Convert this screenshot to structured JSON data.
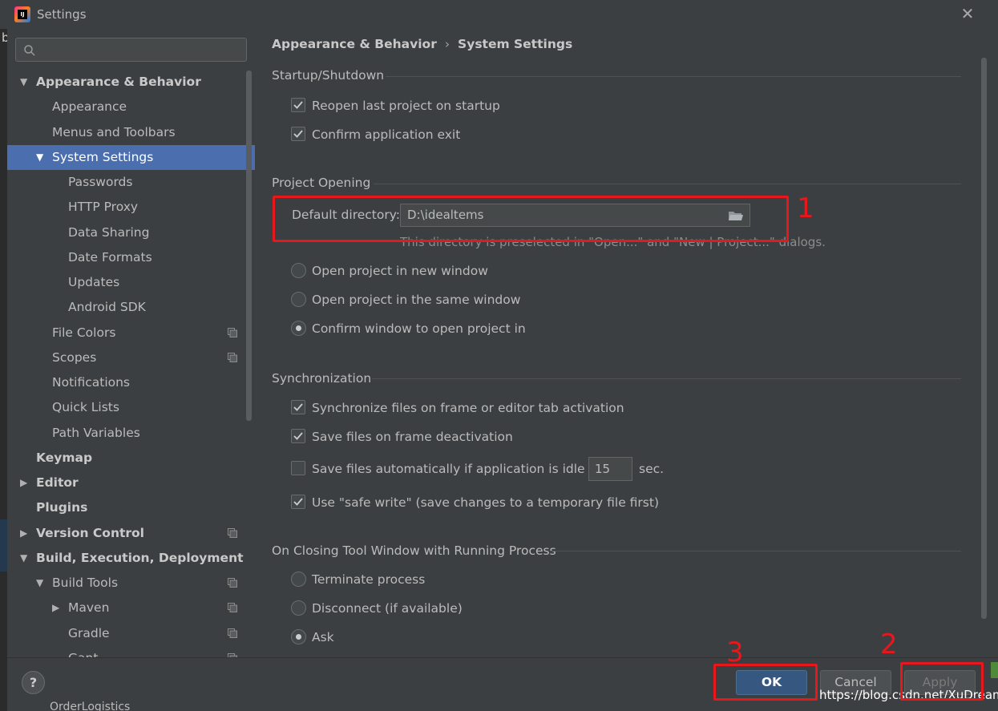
{
  "window": {
    "title": "Settings",
    "app_icon": "intellij-idea-icon"
  },
  "search": {
    "placeholder": ""
  },
  "sidebar": {
    "items": [
      {
        "label": "Appearance & Behavior",
        "level": 0,
        "expanded": true,
        "bold": true
      },
      {
        "label": "Appearance",
        "level": 1
      },
      {
        "label": "Menus and Toolbars",
        "level": 1
      },
      {
        "label": "System Settings",
        "level": 1,
        "expanded": true,
        "selected": true
      },
      {
        "label": "Passwords",
        "level": 2
      },
      {
        "label": "HTTP Proxy",
        "level": 2
      },
      {
        "label": "Data Sharing",
        "level": 2
      },
      {
        "label": "Date Formats",
        "level": 2
      },
      {
        "label": "Updates",
        "level": 2
      },
      {
        "label": "Android SDK",
        "level": 2
      },
      {
        "label": "File Colors",
        "level": 1,
        "project": true
      },
      {
        "label": "Scopes",
        "level": 1,
        "project": true
      },
      {
        "label": "Notifications",
        "level": 1
      },
      {
        "label": "Quick Lists",
        "level": 1
      },
      {
        "label": "Path Variables",
        "level": 1
      },
      {
        "label": "Keymap",
        "level": 0,
        "bold": true
      },
      {
        "label": "Editor",
        "level": 0,
        "collapsed": true,
        "bold": true
      },
      {
        "label": "Plugins",
        "level": 0,
        "bold": true
      },
      {
        "label": "Version Control",
        "level": 0,
        "collapsed": true,
        "bold": true,
        "project": true
      },
      {
        "label": "Build, Execution, Deployment",
        "level": 0,
        "expanded": true,
        "bold": true
      },
      {
        "label": "Build Tools",
        "level": 1,
        "expanded": true,
        "project": true
      },
      {
        "label": "Maven",
        "level": 2,
        "collapsed": true,
        "project": true
      },
      {
        "label": "Gradle",
        "level": 2,
        "project": true
      },
      {
        "label": "Gant",
        "level": 2,
        "project": true
      }
    ]
  },
  "breadcrumb": {
    "parent": "Appearance & Behavior",
    "separator": "›",
    "current": "System Settings"
  },
  "sections": {
    "startup": {
      "title": "Startup/Shutdown",
      "reopen_label": "Reopen last project on startup",
      "confirm_exit_label": "Confirm application exit"
    },
    "project_opening": {
      "title": "Project Opening",
      "default_dir_label": "Default directory:",
      "default_dir_value": "D:\\idealtems",
      "hint": "This directory is preselected in \"Open...\" and \"New | Project...\" dialogs.",
      "radio_new_window": "Open project in new window",
      "radio_same_window": "Open project in the same window",
      "radio_confirm": "Confirm window to open project in"
    },
    "sync": {
      "title": "Synchronization",
      "sync_files_label": "Synchronize files on frame or editor tab activation",
      "save_deactivation_label": "Save files on frame deactivation",
      "save_idle_label": "Save files automatically if application is idle for",
      "idle_value": "15",
      "idle_unit": "sec.",
      "safe_write_label": "Use \"safe write\" (save changes to a temporary file first)"
    },
    "closing": {
      "title": "On Closing Tool Window with Running Process",
      "terminate": "Terminate process",
      "disconnect": "Disconnect (if available)",
      "ask": "Ask"
    }
  },
  "buttons": {
    "help": "?",
    "ok": "OK",
    "cancel": "Cancel",
    "apply": "Apply"
  },
  "annotations": {
    "one": "1",
    "two": "2",
    "three": "3"
  },
  "background": {
    "watermark": "https://blog.csdn.net/XuDream",
    "project_text": "OrderLogistics",
    "edge_char": "b"
  },
  "colors": {
    "selection": "#4b6eaf",
    "ok_button": "#365880",
    "annotation": "#e8171b"
  }
}
